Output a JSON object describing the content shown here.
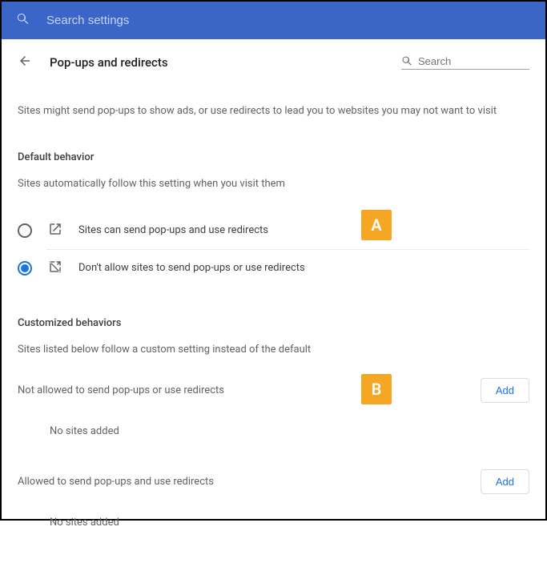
{
  "topbar": {
    "search_placeholder": "Search settings"
  },
  "header": {
    "title": "Pop-ups and redirects",
    "search_placeholder": "Search"
  },
  "description": "Sites might send pop-ups to show ads, or use redirects to lead you to websites you may not want to visit",
  "default_behavior": {
    "title": "Default behavior",
    "subtitle": "Sites automatically follow this setting when you visit them",
    "options": [
      {
        "label": "Sites can send pop-ups and use redirects",
        "selected": false
      },
      {
        "label": "Don't allow sites to send pop-ups or use redirects",
        "selected": true
      }
    ]
  },
  "customized": {
    "title": "Customized behaviors",
    "subtitle": "Sites listed below follow a custom setting instead of the default",
    "sections": [
      {
        "label": "Not allowed to send pop-ups or use redirects",
        "button": "Add",
        "empty": "No sites added"
      },
      {
        "label": "Allowed to send pop-ups and use redirects",
        "button": "Add",
        "empty": "No sites added"
      }
    ]
  },
  "markers": {
    "a": "A",
    "b": "B"
  }
}
